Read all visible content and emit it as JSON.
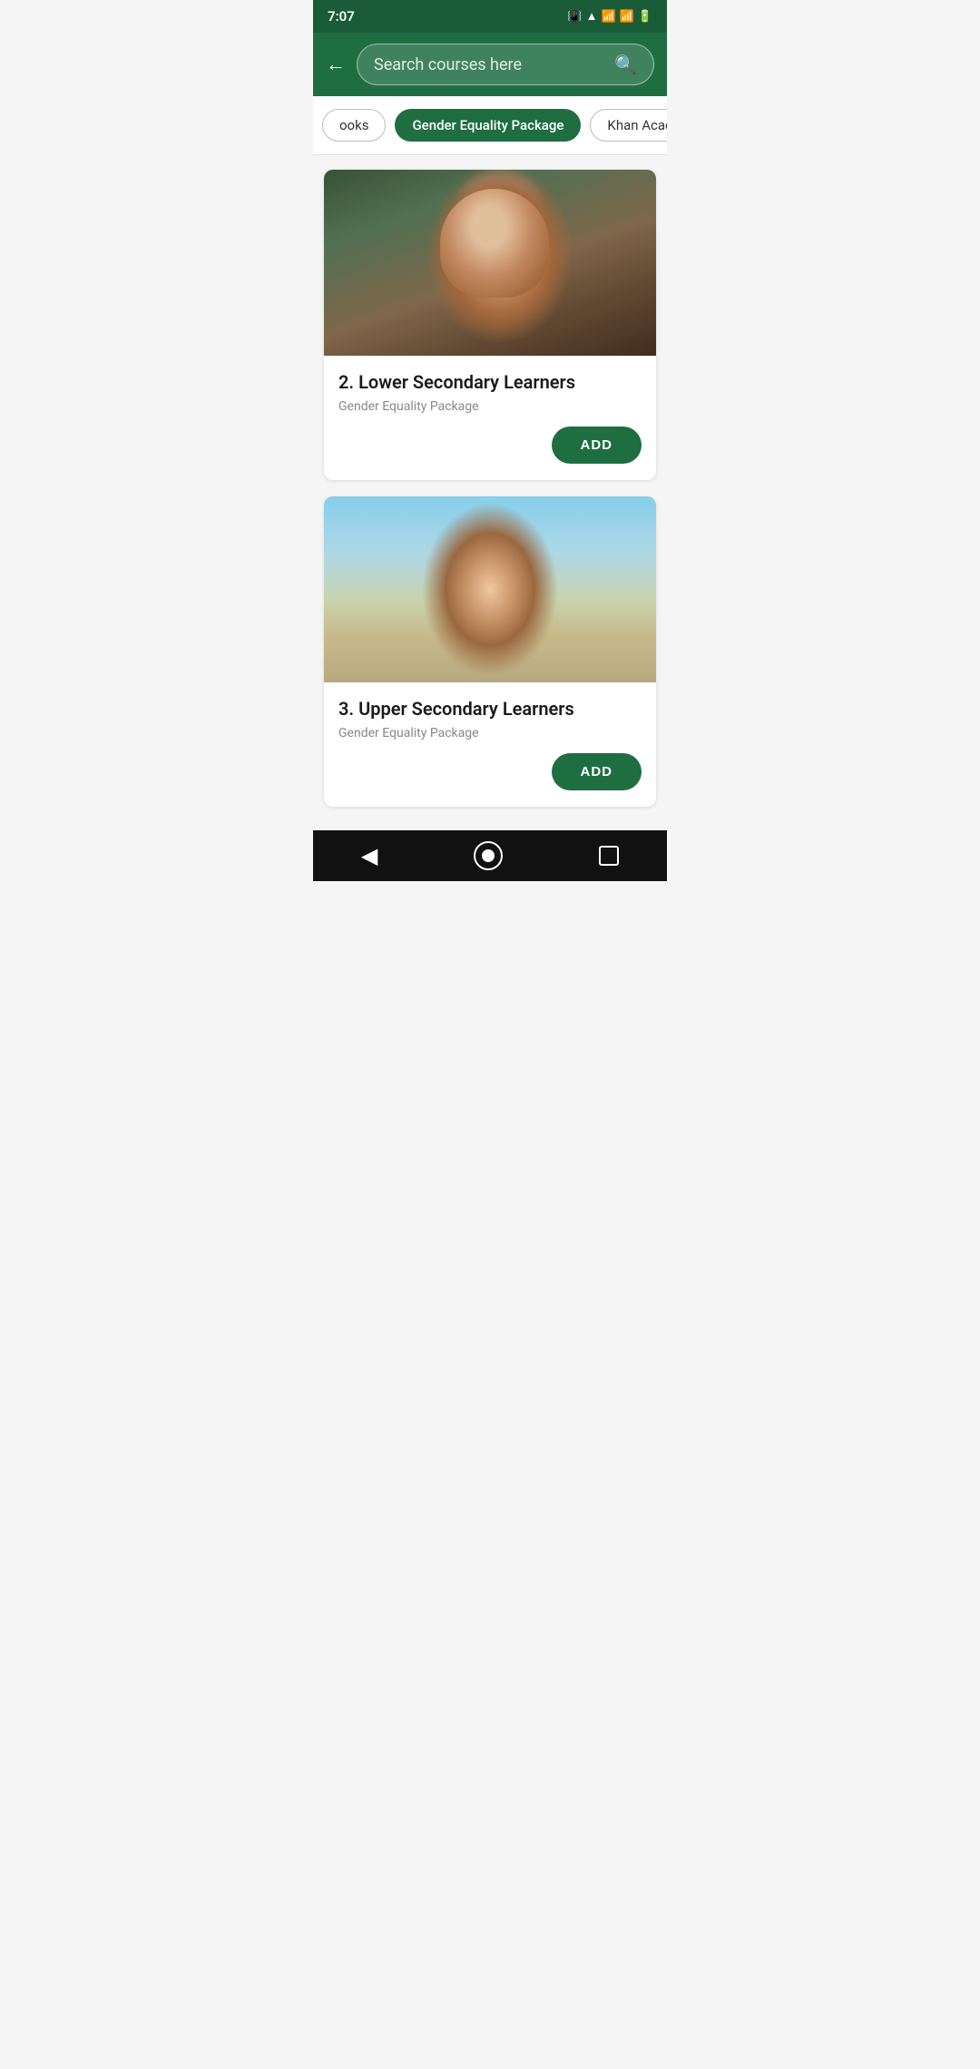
{
  "statusBar": {
    "time": "7:07",
    "icons": "📳 ▲ 📶 📶 🔋"
  },
  "header": {
    "searchPlaceholder": "Search courses here",
    "backLabel": "←",
    "searchIconLabel": "🔍"
  },
  "filters": {
    "chips": [
      {
        "label": "ooks",
        "active": false
      },
      {
        "label": "Gender Equality Package",
        "active": true
      },
      {
        "label": "Khan Acad",
        "active": false
      }
    ]
  },
  "courses": [
    {
      "id": 1,
      "number": "2.",
      "title": "Lower Secondary Learners",
      "category": "Gender Equality Package",
      "addLabel": "ADD"
    },
    {
      "id": 2,
      "number": "3.",
      "title": "Upper Secondary Learners",
      "category": "Gender Equality Package",
      "addLabel": "ADD"
    }
  ],
  "bottomNav": {
    "backLabel": "◀",
    "homeLabel": "●",
    "recentLabel": "■"
  },
  "colors": {
    "primary": "#1e6e42",
    "statusBg": "#1a5c38"
  }
}
